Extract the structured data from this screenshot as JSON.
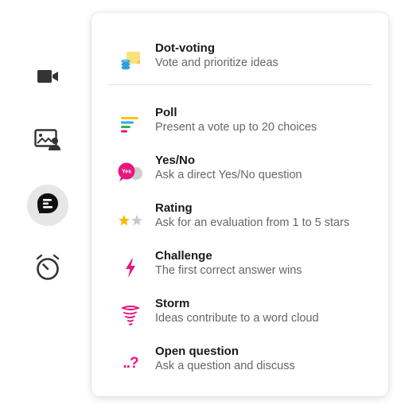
{
  "rail": {
    "items": [
      {
        "icon": "video-camera-icon",
        "active": false
      },
      {
        "icon": "presenter-slides-icon",
        "active": false
      },
      {
        "icon": "chat-bubble-icon",
        "active": true
      },
      {
        "icon": "stopwatch-icon",
        "active": false
      }
    ]
  },
  "menu": {
    "items": [
      {
        "title": "Dot-voting",
        "desc": "Vote and prioritize ideas",
        "icon": "dot-voting-icon"
      },
      {
        "title": "Poll",
        "desc": "Present a vote up to 20 choices",
        "icon": "poll-bars-icon"
      },
      {
        "title": "Yes/No",
        "desc": "Ask a direct Yes/No question",
        "icon": "yes-no-bubbles-icon",
        "icon_text": "Yes"
      },
      {
        "title": "Rating",
        "desc": "Ask for an evaluation from 1 to 5 stars",
        "icon": "rating-stars-icon"
      },
      {
        "title": "Challenge",
        "desc": "The first correct answer wins",
        "icon": "lightning-bolt-icon"
      },
      {
        "title": "Storm",
        "desc": "Ideas contribute to a word cloud",
        "icon": "tornado-icon"
      },
      {
        "title": "Open question",
        "desc": "Ask a question and discuss",
        "icon": "open-question-icon",
        "icon_text": "..?"
      }
    ]
  },
  "colors": {
    "accent_pink": "#e8177d",
    "poll_yellow": "#f5c518",
    "poll_blue": "#3aa0e8",
    "poll_green": "#37b24d",
    "icon_dark": "#333333",
    "active_bg": "#e6e6e6"
  }
}
